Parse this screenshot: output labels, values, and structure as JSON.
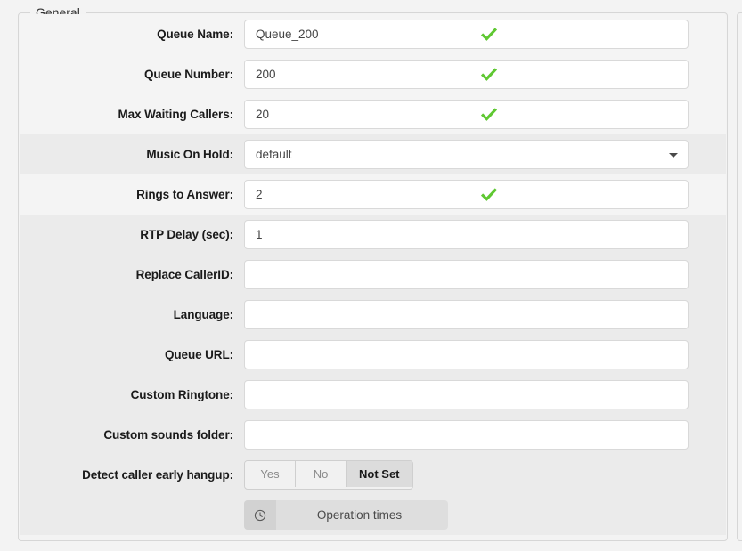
{
  "panel": {
    "legend": "General"
  },
  "rows": [
    {
      "label": "Queue Name:",
      "type": "text",
      "value": "Queue_200",
      "placeholder": "",
      "shade": "light",
      "valid": true,
      "name": "queue-name"
    },
    {
      "label": "Queue Number:",
      "type": "text",
      "value": "200",
      "placeholder": "",
      "shade": "light",
      "valid": true,
      "name": "queue-number"
    },
    {
      "label": "Max Waiting Callers:",
      "type": "text",
      "value": "20",
      "placeholder": "",
      "shade": "light",
      "valid": true,
      "name": "max-waiting-callers"
    },
    {
      "label": "Music On Hold:",
      "type": "select",
      "value": "default",
      "placeholder": "",
      "shade": "dark",
      "valid": false,
      "name": "music-on-hold"
    },
    {
      "label": "Rings to Answer:",
      "type": "text",
      "value": "2",
      "placeholder": "",
      "shade": "light",
      "valid": true,
      "name": "rings-to-answer"
    },
    {
      "label": "RTP Delay (sec):",
      "type": "text",
      "value": "1",
      "placeholder": "",
      "shade": "dark",
      "valid": false,
      "name": "rtp-delay"
    },
    {
      "label": "Replace CallerID:",
      "type": "text",
      "value": "",
      "placeholder": "",
      "shade": "dark",
      "valid": false,
      "name": "replace-callerid"
    },
    {
      "label": "Language:",
      "type": "text",
      "value": "",
      "placeholder": "",
      "shade": "dark",
      "valid": false,
      "name": "language"
    },
    {
      "label": "Queue URL:",
      "type": "text",
      "value": "",
      "placeholder": "",
      "shade": "dark",
      "valid": false,
      "name": "queue-url"
    },
    {
      "label": "Custom Ringtone:",
      "type": "text",
      "value": "",
      "placeholder": "",
      "shade": "dark",
      "valid": false,
      "name": "custom-ringtone"
    },
    {
      "label": "Custom sounds folder:",
      "type": "text",
      "value": "",
      "placeholder": "",
      "shade": "dark",
      "valid": false,
      "name": "custom-sounds-folder"
    }
  ],
  "detect_hangup": {
    "label": "Detect caller early hangup:",
    "options": [
      "Yes",
      "No",
      "Not Set"
    ],
    "selected": "Not Set",
    "shade": "dark"
  },
  "operation_times": {
    "label": "Operation times",
    "icon": "clock-icon",
    "shade": "dark"
  },
  "colors": {
    "valid_check": "#5fc832",
    "panel_border": "#d6d6d6",
    "row_light": "#f4f4f4",
    "row_dark": "#ebebeb",
    "input_border": "#d9d9d9",
    "page_bg": "#f3f3f3",
    "segment_active_bg": "#dcdcdc",
    "op_button_bg": "#dedede"
  }
}
